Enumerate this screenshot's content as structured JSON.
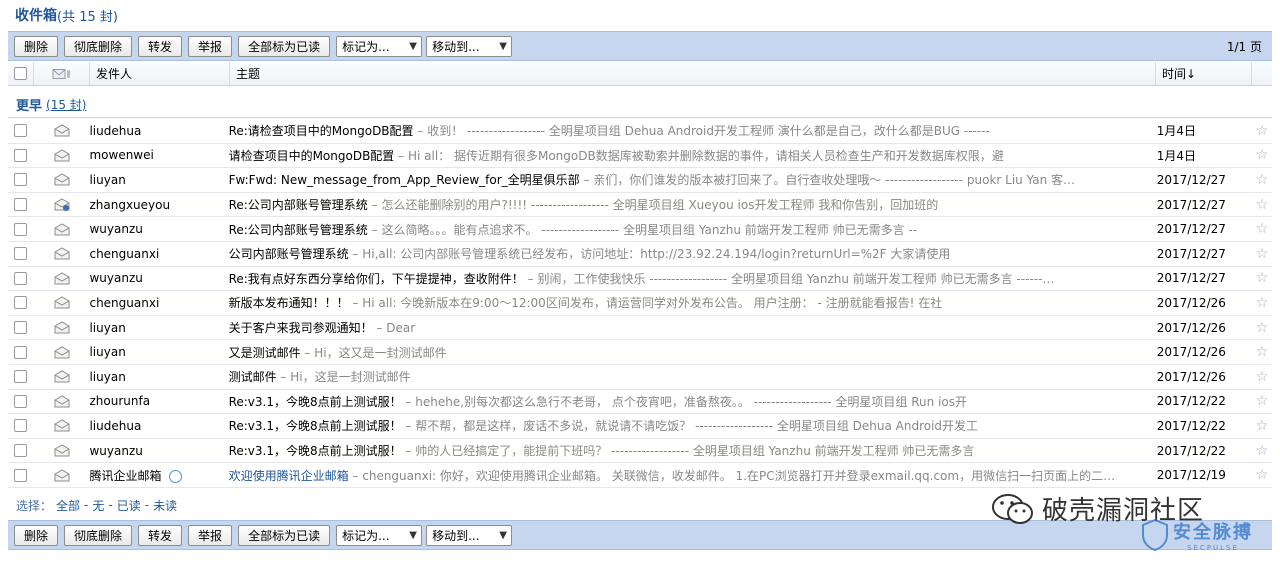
{
  "inbox": {
    "title": "收件箱",
    "count_text": "(共 15 封)"
  },
  "toolbar": {
    "delete": "删除",
    "purge": "彻底删除",
    "forward": "转发",
    "report": "举报",
    "mark_all_read": "全部标为已读",
    "mark_as": "标记为...",
    "move_to": "移动到...",
    "pager": "1/1 页"
  },
  "table": {
    "sender_header": "发件人",
    "subject_header": "主题",
    "time_header": "时间↓"
  },
  "group": {
    "name": "更早",
    "count": "(15 封)"
  },
  "emails": [
    {
      "sender": "liudehua",
      "subject": "Re:请检查项目中的MongoDB配置",
      "preview": "收到！ ------------------ 全明星项目组 Dehua Android开发工程师 演什么都是自己，改什么都是BUG ------",
      "time": "1月4日"
    },
    {
      "sender": "mowenwei",
      "subject": "请检查项目中的MongoDB配置",
      "preview": "Hi all： 据传近期有很多MongoDB数据库被勒索并删除数据的事件，请相关人员检查生产和开发数据库权限，避",
      "time": "1月4日"
    },
    {
      "sender": "liuyan",
      "subject": "Fw:Fwd: New_message_from_App_Review_for_全明星俱乐部",
      "preview": "亲们，你们谁发的版本被打回来了。自行查收处理哦～ ------------------ puokr Liu Yan 客…",
      "time": "2017/12/27"
    },
    {
      "sender": "zhangxueyou",
      "subject": "Re:公司内部账号管理系统",
      "preview": "怎么还能删除别的用户?!!!! ------------------ 全明星项目组 Xueyou ios开发工程师 我和你告别，回加班的",
      "time": "2017/12/27"
    },
    {
      "sender": "wuyanzu",
      "subject": "Re:公司内部账号管理系统",
      "preview": "这么简略。。。能有点追求不。 ------------------ 全明星项目组 Yanzhu 前端开发工程师 帅已无需多言 --",
      "time": "2017/12/27"
    },
    {
      "sender": "chenguanxi",
      "subject": "公司内部账号管理系统",
      "preview": "Hi,all: 公司内部账号管理系统已经发布，访问地址：http://23.92.24.194/login?returnUrl=%2F 大家请使用",
      "time": "2017/12/27"
    },
    {
      "sender": "wuyanzu",
      "subject": "Re:我有点好东西分享给你们，下午提提神，查收附件！",
      "preview": "别闹，工作使我快乐 ------------------ 全明星项目组 Yanzhu 前端开发工程师 帅已无需多言 ------…",
      "time": "2017/12/27"
    },
    {
      "sender": "chenguanxi",
      "subject": "新版本发布通知！！！",
      "preview": "Hi all: 今晚新版本在9:00～12:00区间发布，请运营同学对外发布公告。 用户注册： - 注册就能看报告! 在社",
      "time": "2017/12/26"
    },
    {
      "sender": "liuyan",
      "subject": "关于客户来我司参观通知！",
      "preview": "Dear",
      "time": "2017/12/26"
    },
    {
      "sender": "liuyan",
      "subject": "又是测试邮件",
      "preview": "Hi，这又是一封测试邮件",
      "time": "2017/12/26"
    },
    {
      "sender": "liuyan",
      "subject": "测试邮件",
      "preview": "Hi，这是一封测试邮件",
      "time": "2017/12/26"
    },
    {
      "sender": "zhourunfa",
      "subject": "Re:v3.1，今晚8点前上测试服！",
      "preview": "hehehe,别每次都这么急行不老哥， 点个夜宵吧，准备熬夜。。 ------------------ 全明星项目组 Run ios开",
      "time": "2017/12/22"
    },
    {
      "sender": "liudehua",
      "subject": "Re:v3.1，今晚8点前上测试服！",
      "preview": "帮不帮，都是这样，废话不多说，就说请不请吃饭？ ------------------ 全明星项目组 Dehua Android开发工",
      "time": "2017/12/22"
    },
    {
      "sender": "wuyanzu",
      "subject": "Re:v3.1，今晚8点前上测试服！",
      "preview": "帅的人已经搞定了，能提前下班吗？ ------------------ 全明星项目组 Yanzhu 前端开发工程师 帅已无需多言",
      "time": "2017/12/22"
    },
    {
      "sender": "腾讯企业邮箱",
      "subject": "欢迎使用腾讯企业邮箱",
      "preview": "chenguanxi: 你好，欢迎使用腾讯企业邮箱。 关联微信，收发邮件。 1.在PC浏览器打开并登录exmail.qq.com，用微信扫一扫页面上的二…",
      "time": "2017/12/19"
    }
  ],
  "selection": {
    "label": "选择：",
    "all": "全部",
    "none": "无",
    "read": "已读",
    "unread": "未读",
    "sep": "-"
  },
  "watermark": {
    "text": "破壳漏洞社区",
    "badge_title": "安全脉搏",
    "badge_sub": "SECPULSE"
  },
  "colors": {
    "link": "#1f5799",
    "toolbar_bg": "#c5d6ee",
    "preview_text": "#888888"
  }
}
